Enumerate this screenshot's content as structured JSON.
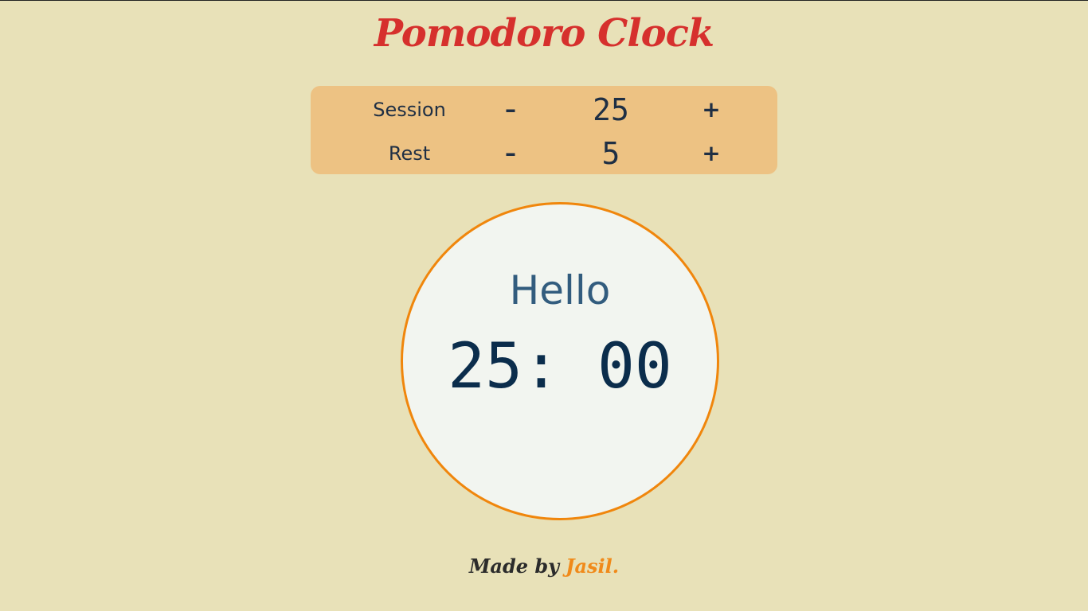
{
  "app": {
    "title": "Pomodoro Clock"
  },
  "settings": {
    "session": {
      "label": "Session",
      "decrement": "–",
      "value": "25",
      "increment": "+"
    },
    "rest": {
      "label": "Rest",
      "decrement": "–",
      "value": "5",
      "increment": "+"
    }
  },
  "timer": {
    "status": "Hello",
    "time": "25: 00"
  },
  "footer": {
    "prefix": "Made by",
    "author": "Jasil."
  },
  "colors": {
    "background": "#e8e1b8",
    "panel": "#edc283",
    "title": "#d6302d",
    "ring": "#f0860c",
    "dial": "#f2f5f0",
    "text": "#1f2f44",
    "author": "#f08a1a"
  }
}
